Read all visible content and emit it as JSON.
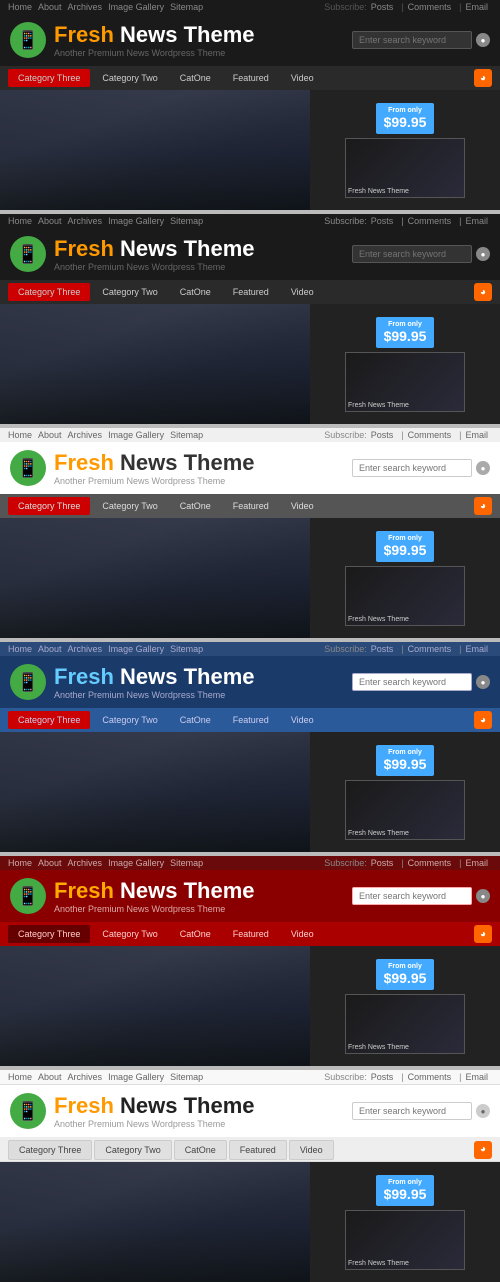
{
  "themes": [
    {
      "id": "dark1",
      "className": "theme-dark",
      "navLinks": [
        "Home",
        "About",
        "Archives",
        "Image Gallery",
        "Sitemap"
      ],
      "subLinks": [
        "Subscribe:",
        "Posts",
        "|",
        "Comments",
        "|",
        "Email"
      ],
      "logoFresh": "Fresh",
      "logoRest": " News Theme",
      "logoSub": "Another Premium News Wordpress Theme",
      "searchPlaceholder": "Enter search keyword",
      "menuItems": [
        "Category Three",
        "Category Two",
        "CatOne",
        "Featured",
        "Video"
      ],
      "priceBadge": "From only\n$99.95"
    },
    {
      "id": "dark2",
      "className": "theme-dark2",
      "navLinks": [
        "Home",
        "About",
        "Archives",
        "Image Gallery",
        "Sitemap"
      ],
      "subLinks": [
        "Subscribe:",
        "Posts",
        "|",
        "Comments",
        "|",
        "Email"
      ],
      "logoFresh": "Fresh",
      "logoRest": " News Theme",
      "logoSub": "Another Premium News Wordpress Theme",
      "searchPlaceholder": "Enter search keyword",
      "menuItems": [
        "Category Three",
        "Category Two",
        "CatOne",
        "Featured",
        "Video"
      ],
      "priceBadge": "From only\n$99.95"
    },
    {
      "id": "light",
      "className": "theme-light",
      "navLinks": [
        "Home",
        "About",
        "Archives",
        "Image Gallery",
        "Sitemap"
      ],
      "subLinks": [
        "Subscribe:",
        "Posts",
        "|",
        "Comments",
        "|",
        "Email"
      ],
      "logoFresh": "Fresh",
      "logoRest": " News Theme",
      "logoSub": "Another Premium News Wordpress Theme",
      "searchPlaceholder": "Enter search keyword",
      "menuItems": [
        "Category Three",
        "Category Two",
        "CatOne",
        "Featured",
        "Video"
      ],
      "priceBadge": "From only\n$99.95"
    },
    {
      "id": "blue",
      "className": "theme-blue",
      "navLinks": [
        "Home",
        "About",
        "Archives",
        "Image Gallery",
        "Sitemap"
      ],
      "subLinks": [
        "Subscribe:",
        "Posts",
        "|",
        "Comments",
        "|",
        "Email"
      ],
      "logoFresh": "Fresh",
      "logoRest": " News Theme",
      "logoSub": "Another Premium News Wordpress Theme",
      "searchPlaceholder": "Enter search keyword",
      "menuItems": [
        "Category Three",
        "Category Two",
        "CatOne",
        "Featured",
        "Video"
      ],
      "priceBadge": "From only\n$99.95"
    },
    {
      "id": "red",
      "className": "theme-red",
      "navLinks": [
        "Home",
        "About",
        "Archives",
        "Image Gallery",
        "Sitemap"
      ],
      "subLinks": [
        "Subscribe:",
        "Posts",
        "|",
        "Comments",
        "|",
        "Email"
      ],
      "logoFresh": "Fresh",
      "logoRest": " News Theme",
      "logoSub": "Another Premium News Wordpress Theme",
      "searchPlaceholder": "Enter search keyword",
      "menuItems": [
        "Category Three",
        "Category Two",
        "CatOne",
        "Featured",
        "Video"
      ],
      "priceBadge": "From only\n$99.95"
    },
    {
      "id": "white",
      "className": "theme-white",
      "navLinks": [
        "Home",
        "About",
        "Archives",
        "Image Gallery",
        "Sitemap"
      ],
      "subLinks": [
        "Subscribe:",
        "Posts",
        "|",
        "Comments",
        "|",
        "Email"
      ],
      "logoFresh": "Fresh",
      "logoRest": " News Theme",
      "logoSub": "Another Premium News Wordpress Theme",
      "searchPlaceholder": "Enter search keyword",
      "menuItems": [
        "Category Three",
        "Category Two",
        "CatOne",
        "Featured",
        "Video"
      ],
      "priceBadge": "From only\n$99.95"
    }
  ],
  "freshNewsTheme": "Fresh News Theme",
  "subtitle": "Another Premium News Wordpress Theme"
}
